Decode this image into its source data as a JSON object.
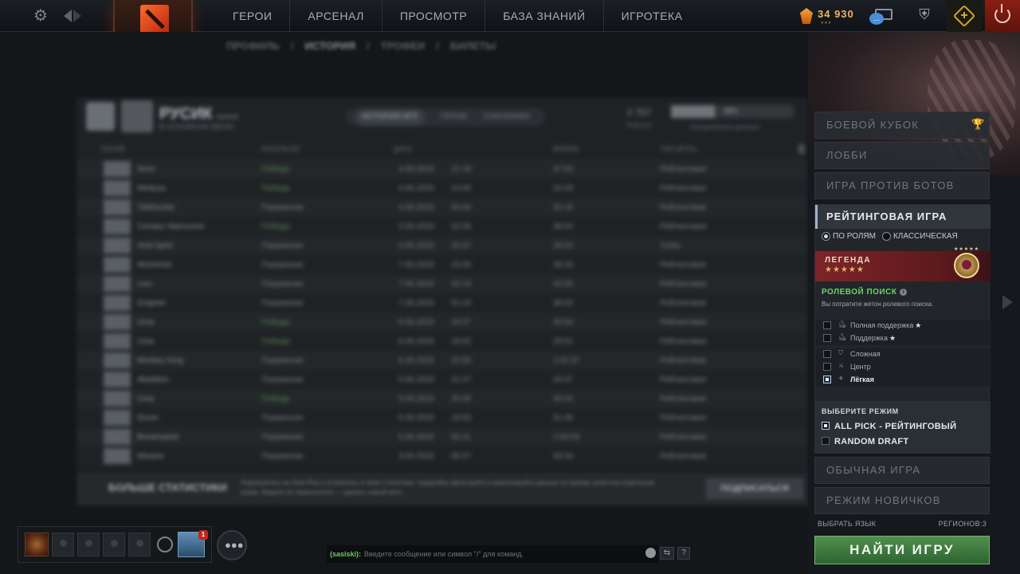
{
  "topbar": {
    "nav": [
      "ГЕРОИ",
      "АРСЕНАЛ",
      "ПРОСМОТР",
      "БАЗА ЗНАНИЙ",
      "ИГРОТЕКА"
    ],
    "shards": "34 930",
    "shards_dots": "●●●",
    "chat_bubble": "…"
  },
  "profile": {
    "tabs": [
      "ПРОФИЛЬ",
      "ИСТОРИЯ",
      "ТРОФЕИ",
      "БИЛЕТЫ"
    ],
    "name": "РУСИК",
    "name_tag": "Icelord",
    "sub": "В ОСНОВНОМ МЕНЮ",
    "view_tabs": [
      "ИСТОРИЯ ИГР",
      "ГЕРОИ",
      "СОЮЗНИКИ"
    ],
    "stat_value": "2 707",
    "stat_label": "Рейтинг",
    "bar_value": "38%",
    "bar_fill": 0.36,
    "bar_label": "Ежедневные данные",
    "columns": [
      "ГЕРОЙ",
      "РЕЗУЛЬТАТ",
      "ДАТА",
      "ВРЕМЯ",
      "ТИП ИГРЫ"
    ],
    "rows": [
      {
        "hero": "Sven",
        "result": "Победа",
        "win": true,
        "date": "4.06.2023",
        "time": "21:18",
        "dur": "47:53",
        "mode": "Рейтинговая"
      },
      {
        "hero": "Medusa",
        "result": "Победа",
        "win": true,
        "date": "4.06.2023",
        "time": "14:05",
        "dur": "24:29",
        "mode": "Рейтинговая"
      },
      {
        "hero": "Tidehunter",
        "result": "Поражение",
        "win": false,
        "date": "4.06.2023",
        "time": "00:44",
        "dur": "32:15",
        "mode": "Рейтинговая"
      },
      {
        "hero": "Centaur Warrunner",
        "result": "Победа",
        "win": true,
        "date": "3.06.2023",
        "time": "22:39",
        "dur": "38:03",
        "mode": "Рейтинговая"
      },
      {
        "hero": "Void Spirit",
        "result": "Поражение",
        "win": false,
        "date": "3.06.2023",
        "time": "20:37",
        "dur": "28:53",
        "mode": "Turbo"
      },
      {
        "hero": "Alchemist",
        "result": "Поражение",
        "win": false,
        "date": "7.06.2023",
        "time": "23:45",
        "dur": "39:26",
        "mode": "Рейтинговая"
      },
      {
        "hero": "Lion",
        "result": "Поражение",
        "win": false,
        "date": "7.06.2023",
        "time": "02:19",
        "dur": "42:09",
        "mode": "Рейтинговая"
      },
      {
        "hero": "Grapher",
        "result": "Поражение",
        "win": false,
        "date": "7.06.2023",
        "time": "01:23",
        "dur": "38:53",
        "mode": "Рейтинговая"
      },
      {
        "hero": "Ursa",
        "result": "Победа",
        "win": true,
        "date": "6.06.2023",
        "time": "19:27",
        "dur": "40:53",
        "mode": "Рейтинговая"
      },
      {
        "hero": "Ursa",
        "result": "Победа",
        "win": true,
        "date": "6.06.2023",
        "time": "18:02",
        "dur": "29:51",
        "mode": "Рейтинговая"
      },
      {
        "hero": "Monkey King",
        "result": "Поражение",
        "win": false,
        "date": "5.06.2023",
        "time": "22:55",
        "dur": "1:02:37",
        "mode": "Рейтинговая"
      },
      {
        "hero": "Abaddon",
        "result": "Поражение",
        "win": false,
        "date": "5.06.2023",
        "time": "21:47",
        "dur": "43:37",
        "mode": "Рейтинговая"
      },
      {
        "hero": "Ursa",
        "result": "Победа",
        "win": true,
        "date": "5.06.2023",
        "time": "20:29",
        "dur": "43:16",
        "mode": "Рейтинговая"
      },
      {
        "hero": "Doom",
        "result": "Поражение",
        "win": false,
        "date": "5.06.2023",
        "time": "19:53",
        "dur": "51:48",
        "mode": "Рейтинговая"
      },
      {
        "hero": "Brewmaster",
        "result": "Поражение",
        "win": false,
        "date": "5.06.2023",
        "time": "03:11",
        "dur": "1:04:03",
        "mode": "Рейтинговая"
      },
      {
        "hero": "Weaver",
        "result": "Поражение",
        "win": false,
        "date": "3.06.2023",
        "time": "06:37",
        "dur": "33:34",
        "mode": "Рейтинговая"
      }
    ],
    "promo_title": "БОЛЬШЕ СТАТИСТИКИ",
    "promo_desc": "Подпишитесь на Dota Plus и углубитесь в свою статистику: подпробно фильтруйте и анализируйте данные по героям, роли или отдельным играм. Модели не переносятся — сделать новый матч.",
    "promo_button": "ПОДПИСАТЬСЯ"
  },
  "right": {
    "battle_cup": "БОЕВОЙ КУБОК",
    "lobby": "ЛОББИ",
    "bots": "ИГРА ПРОТИВ БОТОВ",
    "ranked_title": "РЕЙТИНГОВАЯ ИГРА",
    "radio_roles": "ПО РОЛЯМ",
    "radio_classic": "КЛАССИЧЕСКАЯ",
    "rank_name": "ЛЕГЕНДА",
    "rank_stars": "★★★★★",
    "medal_stars": "★★★★★",
    "role_search_title": "РОЛЕВОЙ ПОИСК",
    "role_search_note": "Вы потратите жетон ролевого поиска.",
    "roles_a": [
      {
        "label": "Полная поддержка",
        "icon": "⛸",
        "checked": false,
        "star": "★"
      },
      {
        "label": "Поддержка",
        "icon": "⛸",
        "checked": false,
        "star": "★"
      }
    ],
    "roles_b": [
      {
        "label": "Сложная",
        "icon": "⛉",
        "checked": false
      },
      {
        "label": "Центр",
        "icon": "⚔",
        "checked": false
      },
      {
        "label": "Лёгкая",
        "icon": "✈",
        "checked": true
      }
    ],
    "mode_title": "ВЫБЕРИТЕ РЕЖИМ",
    "mode_allpick": "ALL PICK - РЕЙТИНГОВЫЙ",
    "mode_random": "RANDOM DRAFT",
    "normal": "ОБЫЧНАЯ ИГРА",
    "newbie": "РЕЖИМ НОВИЧКОВ",
    "language": "ВЫБРАТЬ ЯЗЫК",
    "regions": "РЕГИОНОВ:3",
    "find_game": "НАЙТИ ИГРУ"
  },
  "bottom": {
    "game_badge": "1",
    "chat_name": "(sasiski):",
    "chat_placeholder": "Введите сообщение или символ \"/\" для команд.",
    "help": "?"
  }
}
